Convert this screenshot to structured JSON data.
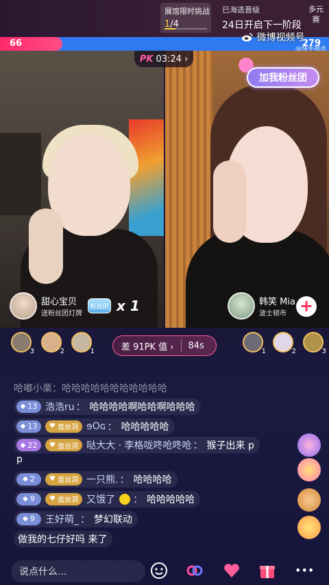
{
  "topbar": {
    "challenge_title": "展馆限时挑战",
    "challenge_current": "1",
    "challenge_total": "/4",
    "challenge_progress": 0.25,
    "sea_status": "已海选晋级",
    "sea_next": "24日开启下一阶段",
    "multi_label": "多元赛"
  },
  "scorebar": {
    "left_score": "66",
    "right_score": "279",
    "left_share": 0.19,
    "left_color": "#ff2a6a",
    "right_color": "#2f7af0"
  },
  "watermark": {
    "name": "微博视频号",
    "sub": "@快手视点"
  },
  "pk": {
    "mark": "PK",
    "time": "03:24",
    "chevron": "›"
  },
  "sticker": {
    "label": "加我粉丝团"
  },
  "left_host": {
    "name": "甜心宝贝",
    "sub": "送粉丝团灯牌",
    "badge": "粉丝团",
    "count": "x 1"
  },
  "right_host": {
    "name": "韩笑 Mia",
    "sub": "波士顿市",
    "follow": "+"
  },
  "contributors_left": [
    {
      "rank": "3",
      "color": "#8a7b6f"
    },
    {
      "rank": "2",
      "color": "#d9b08c"
    },
    {
      "rank": "1",
      "color": "#c5b7a0"
    }
  ],
  "contributors_right": [
    {
      "rank": "1",
      "color": "#6d6a75"
    },
    {
      "rank": "2",
      "color": "#e0d8e8"
    },
    {
      "rank": "3",
      "color": "#b0924a"
    }
  ],
  "pk_diff": {
    "label": "差 91PK 值 ›",
    "time": "84s"
  },
  "comments": [
    {
      "faded": true,
      "text": "哈嘟小栗：哈哈哈哈哈哈哈哈哈哈哈"
    },
    {
      "level": "13",
      "user": "浩浩ru",
      "text": "哈哈哈哈啊哈哈啊哈哈哈"
    },
    {
      "level": "13",
      "fan": "盘丝洞",
      "user": "ɘOɢ",
      "text": "哈哈哈哈哈"
    },
    {
      "level": "22",
      "purple": true,
      "fan": "盘丝洞",
      "user": "哒大大 · 李格咙咚呛咚呛",
      "text": "猴子出来 p",
      "wrap": "p"
    },
    {
      "level": "2",
      "fan": "盘丝洞",
      "user": "一只熊.",
      "text": "哈哈哈哈"
    },
    {
      "level": "9",
      "fan": "盘丝洞",
      "user": "又饿了",
      "emoji": true,
      "text": "哈哈哈哈哈"
    },
    {
      "level": "9",
      "user": "王好萌_",
      "text": "梦幻联动"
    },
    {
      "plain": true,
      "text": "做我的七仔好吗  来了"
    }
  ],
  "bottom": {
    "placeholder": "说点什么...",
    "icons": [
      "smile-icon",
      "link-pk-icon",
      "heart-gift-icon",
      "gift-box-icon",
      "more-icon"
    ],
    "more": "•••"
  }
}
